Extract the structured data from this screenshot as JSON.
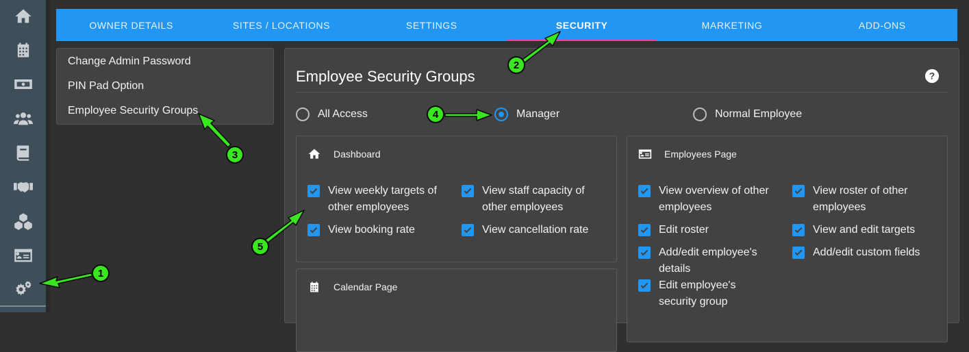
{
  "sidebar": {
    "items": [
      {
        "icon": "home-icon"
      },
      {
        "icon": "calendar-icon"
      },
      {
        "icon": "money-icon"
      },
      {
        "icon": "users-icon"
      },
      {
        "icon": "book-icon"
      },
      {
        "icon": "handshake-icon"
      },
      {
        "icon": "boxes-icon"
      },
      {
        "icon": "id-card-icon"
      },
      {
        "icon": "gears-icon"
      }
    ]
  },
  "tabs": [
    "OWNER DETAILS",
    "SITES / LOCATIONS",
    "SETTINGS",
    "SECURITY",
    "MARKETING",
    "ADD-ONS"
  ],
  "active_tab": "SECURITY",
  "menu": {
    "items": [
      "Change Admin Password",
      "PIN Pad Option",
      "Employee Security Groups"
    ]
  },
  "panel": {
    "title": "Employee Security Groups",
    "help_icon": "help-icon",
    "radios": [
      {
        "label": "All Access",
        "checked": false
      },
      {
        "label": "Manager",
        "checked": true
      },
      {
        "label": "Normal Employee",
        "checked": false
      }
    ],
    "dashboard": {
      "title": "Dashboard",
      "items": [
        "View weekly targets of other employees",
        "View staff capacity of other employees",
        "View booking rate",
        "View cancellation rate"
      ]
    },
    "employees": {
      "title": "Employees Page",
      "items": [
        "View overview of other employees",
        "View roster of other employees",
        "Edit roster",
        "View and edit targets",
        "Add/edit employee's details",
        "Add/edit custom fields",
        "Edit employee's security group"
      ]
    },
    "calendar": {
      "title": "Calendar Page"
    }
  },
  "callouts": [
    "1",
    "2",
    "3",
    "4",
    "5"
  ],
  "colors": {
    "accent": "#2196f3",
    "callout": "#39e61f",
    "sidebar": "#3f4f59",
    "panel": "#424242"
  }
}
